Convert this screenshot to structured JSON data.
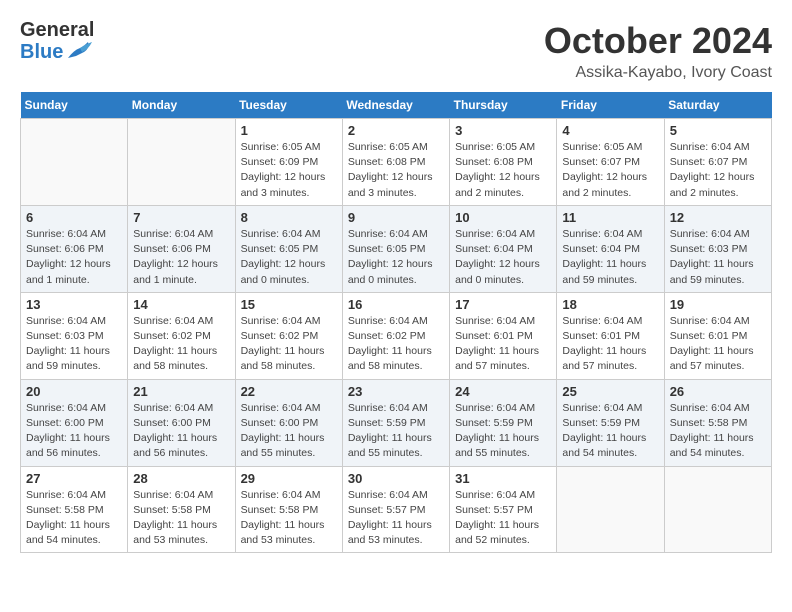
{
  "header": {
    "logo_general": "General",
    "logo_blue": "Blue",
    "title": "October 2024",
    "subtitle": "Assika-Kayabo, Ivory Coast"
  },
  "calendar": {
    "days_of_week": [
      "Sunday",
      "Monday",
      "Tuesday",
      "Wednesday",
      "Thursday",
      "Friday",
      "Saturday"
    ],
    "weeks": [
      [
        {
          "day": "",
          "content": ""
        },
        {
          "day": "",
          "content": ""
        },
        {
          "day": "1",
          "content": "Sunrise: 6:05 AM\nSunset: 6:09 PM\nDaylight: 12 hours\nand 3 minutes."
        },
        {
          "day": "2",
          "content": "Sunrise: 6:05 AM\nSunset: 6:08 PM\nDaylight: 12 hours\nand 3 minutes."
        },
        {
          "day": "3",
          "content": "Sunrise: 6:05 AM\nSunset: 6:08 PM\nDaylight: 12 hours\nand 2 minutes."
        },
        {
          "day": "4",
          "content": "Sunrise: 6:05 AM\nSunset: 6:07 PM\nDaylight: 12 hours\nand 2 minutes."
        },
        {
          "day": "5",
          "content": "Sunrise: 6:04 AM\nSunset: 6:07 PM\nDaylight: 12 hours\nand 2 minutes."
        }
      ],
      [
        {
          "day": "6",
          "content": "Sunrise: 6:04 AM\nSunset: 6:06 PM\nDaylight: 12 hours\nand 1 minute."
        },
        {
          "day": "7",
          "content": "Sunrise: 6:04 AM\nSunset: 6:06 PM\nDaylight: 12 hours\nand 1 minute."
        },
        {
          "day": "8",
          "content": "Sunrise: 6:04 AM\nSunset: 6:05 PM\nDaylight: 12 hours\nand 0 minutes."
        },
        {
          "day": "9",
          "content": "Sunrise: 6:04 AM\nSunset: 6:05 PM\nDaylight: 12 hours\nand 0 minutes."
        },
        {
          "day": "10",
          "content": "Sunrise: 6:04 AM\nSunset: 6:04 PM\nDaylight: 12 hours\nand 0 minutes."
        },
        {
          "day": "11",
          "content": "Sunrise: 6:04 AM\nSunset: 6:04 PM\nDaylight: 11 hours\nand 59 minutes."
        },
        {
          "day": "12",
          "content": "Sunrise: 6:04 AM\nSunset: 6:03 PM\nDaylight: 11 hours\nand 59 minutes."
        }
      ],
      [
        {
          "day": "13",
          "content": "Sunrise: 6:04 AM\nSunset: 6:03 PM\nDaylight: 11 hours\nand 59 minutes."
        },
        {
          "day": "14",
          "content": "Sunrise: 6:04 AM\nSunset: 6:02 PM\nDaylight: 11 hours\nand 58 minutes."
        },
        {
          "day": "15",
          "content": "Sunrise: 6:04 AM\nSunset: 6:02 PM\nDaylight: 11 hours\nand 58 minutes."
        },
        {
          "day": "16",
          "content": "Sunrise: 6:04 AM\nSunset: 6:02 PM\nDaylight: 11 hours\nand 58 minutes."
        },
        {
          "day": "17",
          "content": "Sunrise: 6:04 AM\nSunset: 6:01 PM\nDaylight: 11 hours\nand 57 minutes."
        },
        {
          "day": "18",
          "content": "Sunrise: 6:04 AM\nSunset: 6:01 PM\nDaylight: 11 hours\nand 57 minutes."
        },
        {
          "day": "19",
          "content": "Sunrise: 6:04 AM\nSunset: 6:01 PM\nDaylight: 11 hours\nand 57 minutes."
        }
      ],
      [
        {
          "day": "20",
          "content": "Sunrise: 6:04 AM\nSunset: 6:00 PM\nDaylight: 11 hours\nand 56 minutes."
        },
        {
          "day": "21",
          "content": "Sunrise: 6:04 AM\nSunset: 6:00 PM\nDaylight: 11 hours\nand 56 minutes."
        },
        {
          "day": "22",
          "content": "Sunrise: 6:04 AM\nSunset: 6:00 PM\nDaylight: 11 hours\nand 55 minutes."
        },
        {
          "day": "23",
          "content": "Sunrise: 6:04 AM\nSunset: 5:59 PM\nDaylight: 11 hours\nand 55 minutes."
        },
        {
          "day": "24",
          "content": "Sunrise: 6:04 AM\nSunset: 5:59 PM\nDaylight: 11 hours\nand 55 minutes."
        },
        {
          "day": "25",
          "content": "Sunrise: 6:04 AM\nSunset: 5:59 PM\nDaylight: 11 hours\nand 54 minutes."
        },
        {
          "day": "26",
          "content": "Sunrise: 6:04 AM\nSunset: 5:58 PM\nDaylight: 11 hours\nand 54 minutes."
        }
      ],
      [
        {
          "day": "27",
          "content": "Sunrise: 6:04 AM\nSunset: 5:58 PM\nDaylight: 11 hours\nand 54 minutes."
        },
        {
          "day": "28",
          "content": "Sunrise: 6:04 AM\nSunset: 5:58 PM\nDaylight: 11 hours\nand 53 minutes."
        },
        {
          "day": "29",
          "content": "Sunrise: 6:04 AM\nSunset: 5:58 PM\nDaylight: 11 hours\nand 53 minutes."
        },
        {
          "day": "30",
          "content": "Sunrise: 6:04 AM\nSunset: 5:57 PM\nDaylight: 11 hours\nand 53 minutes."
        },
        {
          "day": "31",
          "content": "Sunrise: 6:04 AM\nSunset: 5:57 PM\nDaylight: 11 hours\nand 52 minutes."
        },
        {
          "day": "",
          "content": ""
        },
        {
          "day": "",
          "content": ""
        }
      ]
    ]
  }
}
